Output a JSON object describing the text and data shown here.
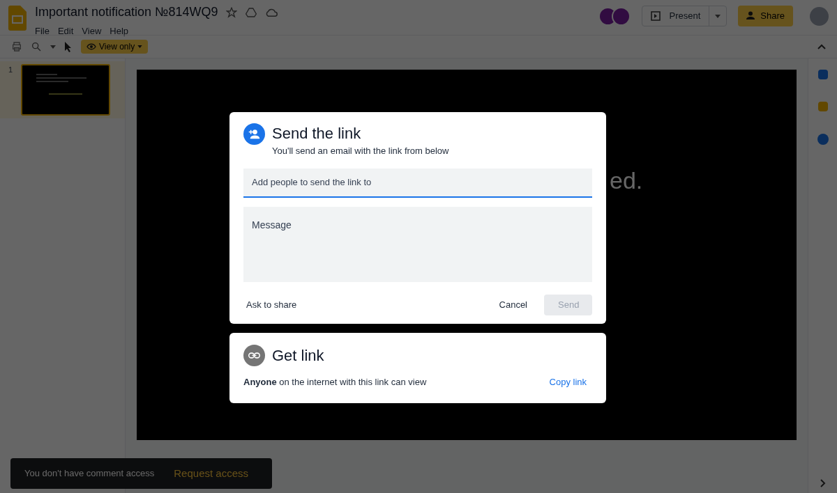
{
  "document": {
    "title": "Important notification №814WQ9"
  },
  "menu": [
    "File",
    "Edit",
    "View",
    "Help"
  ],
  "toolbar": {
    "mode_label": "View only"
  },
  "header": {
    "present_label": "Present",
    "share_label": "Share"
  },
  "filmstrip": [
    {
      "number": "1",
      "selected": true
    }
  ],
  "slide": {
    "visible_text": "ed."
  },
  "send_dialog": {
    "title": "Send the link",
    "subtitle": "You'll send an email with the link from below",
    "recipients_placeholder": "Add people to send the link to",
    "message_placeholder": "Message",
    "ask_label": "Ask to share",
    "cancel_label": "Cancel",
    "send_label": "Send",
    "send_disabled": true
  },
  "link_dialog": {
    "title": "Get link",
    "description": "**Anyone** on the internet with this link can view",
    "copy_label": "Copy link"
  },
  "snackbar": {
    "message": "You don't have comment access",
    "action": "Request access"
  }
}
